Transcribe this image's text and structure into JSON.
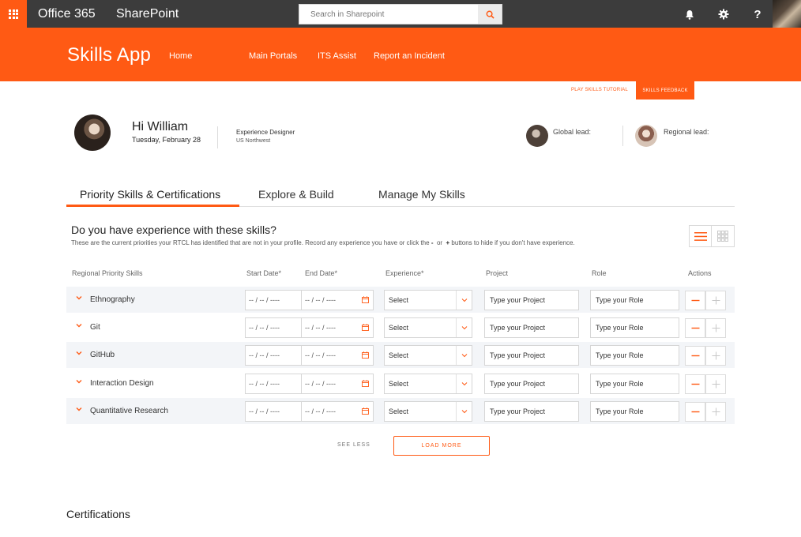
{
  "suite": {
    "office": "Office 365",
    "app": "SharePoint",
    "search_placeholder": "Search in Sharepoint",
    "help_label": "?"
  },
  "appbar": {
    "title": "Skills App",
    "nav": [
      "Home",
      "Main Portals",
      "ITS Assist",
      "Report an Incident"
    ]
  },
  "actions": {
    "tutorial": "PLAY SKILLS TUTORIAL",
    "feedback": "SKILLS FEEDBACK"
  },
  "profile": {
    "greeting": "Hi William",
    "date": "Tuesday, February 28",
    "title": "Experience Designer",
    "location": "US Northwest",
    "global_lead": "Global lead:",
    "regional_lead": "Regional lead:"
  },
  "tabs": [
    "Priority Skills & Certifications",
    "Explore & Build",
    "Manage My Skills"
  ],
  "section": {
    "title": "Do you have experience with these skills?",
    "desc_1": "These are the current priorities your RTCL has identified that are not in your profile. Record any experience you have or click the",
    "minus": "-",
    "or": "or",
    "plus": "+",
    "desc_2": "buttons to hide if you don't have experience."
  },
  "table": {
    "headers": [
      "Regional Priority Skills",
      "Start Date*",
      "End Date*",
      "Experience*",
      "Project",
      "Role",
      "Actions"
    ],
    "date_placeholder": "-- / -- / ----",
    "select_label": "Select",
    "project_placeholder": "Type your Project",
    "role_placeholder": "Type your Role",
    "skills": [
      "Ethnography",
      "Git",
      "GitHub",
      "Interaction Design",
      "Quantitative Research"
    ]
  },
  "footer": {
    "see_less": "SEE LESS",
    "load_more": "LOAD MORE",
    "certifications": "Certifications"
  },
  "colors": {
    "accent": "#ff5a14",
    "suitebar": "#3c3c3c"
  }
}
